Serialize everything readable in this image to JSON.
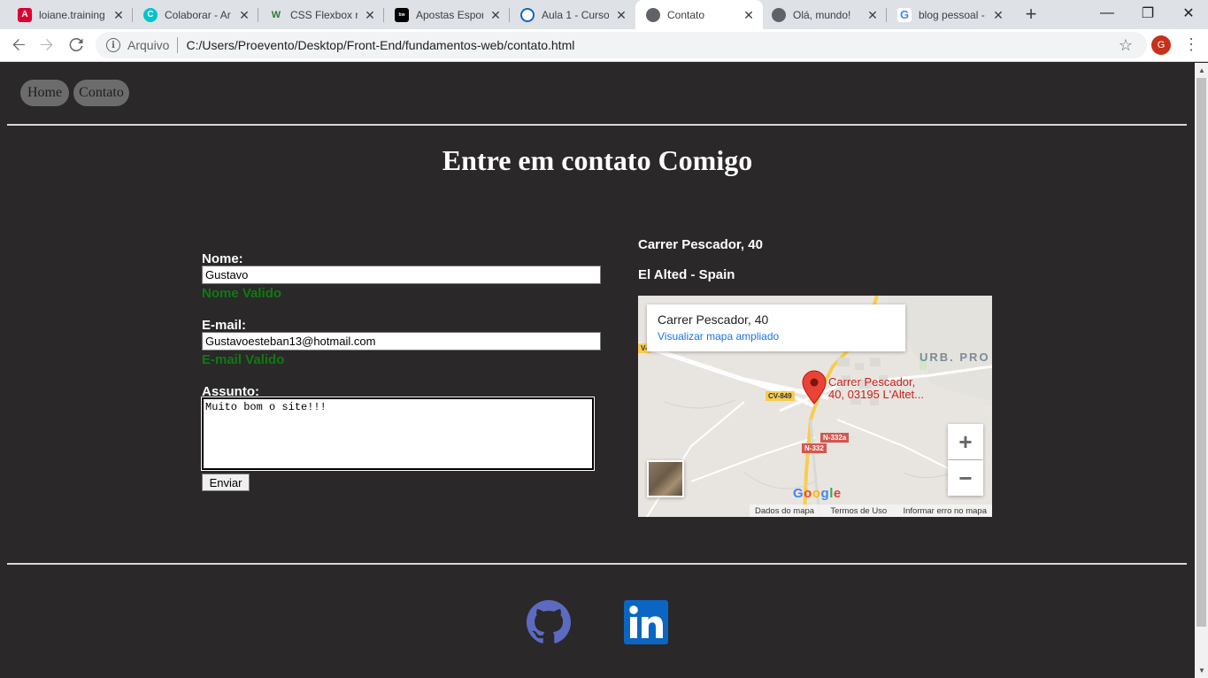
{
  "browser": {
    "tabs": [
      {
        "title": "loiane.training",
        "icon": "angular-icon",
        "color": "#dd0031",
        "active": false
      },
      {
        "title": "Colaborar - Ar",
        "icon": "canva-icon",
        "color": "#00c4cc",
        "active": false
      },
      {
        "title": "CSS Flexbox re",
        "icon": "w3-icon",
        "color": "#4caf50",
        "active": false
      },
      {
        "title": "Apostas Espor",
        "icon": "betway-icon",
        "color": "#000000",
        "active": false
      },
      {
        "title": "Aula 1 - Curso",
        "icon": "clock-icon",
        "color": "#1565c0",
        "active": false
      },
      {
        "title": "Contato",
        "icon": "globe-icon",
        "color": "#5f6368",
        "active": true
      },
      {
        "title": "Olá, mundo!",
        "icon": "globe-icon",
        "color": "#5f6368",
        "active": false
      },
      {
        "title": "blog pessoal -",
        "icon": "google-icon",
        "color": "#4285f4",
        "active": false
      }
    ],
    "new_tab_symbol": "+",
    "address": {
      "scheme_label": "Arquivo",
      "url": "C:/Users/Proevento/Desktop/Front-End/fundamentos-web/contato.html"
    },
    "profile_initial": "G"
  },
  "page": {
    "nav": {
      "home": "Home",
      "contact": "Contato"
    },
    "heading": "Entre em contato Comigo",
    "form": {
      "name_label": "Nome:",
      "name_value": "Gustavo",
      "name_status": "Nome Valido",
      "email_label": "E-mail:",
      "email_value": "Gustavoesteban13@hotmail.com",
      "email_status": "E-mail Valido",
      "subject_label": "Assunto:",
      "subject_value": "Muito bom o site!!!",
      "submit_label": "Enviar",
      "valid_color": "#0f7a0f"
    },
    "address": {
      "line1": "Carrer Pescador, 40",
      "line2": "El Alted - Spain"
    },
    "map": {
      "card_title": "Carrer Pescador, 40",
      "card_link": "Visualizar mapa ampliado",
      "pin_label_1": "Carrer Pescador,",
      "pin_label_2": "40, 03195 L'Altet...",
      "region_label": "URB. PRO",
      "road_cv849": "CV-849",
      "road_n332a": "N-332a",
      "road_n332": "N-332",
      "road_cv_partial": "V-",
      "zoom_in": "+",
      "zoom_out": "−",
      "footer_data": "Dados do mapa",
      "footer_terms": "Termos de Uso",
      "footer_report": "Informar erro no mapa",
      "logo_text": "Google"
    },
    "social": [
      {
        "name": "github-icon",
        "color": "#5c6bc0"
      },
      {
        "name": "linkedin-icon",
        "color": "#0a66c2"
      }
    ]
  }
}
